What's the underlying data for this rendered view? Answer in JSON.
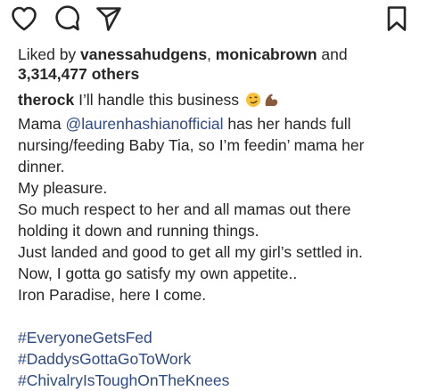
{
  "actions": {
    "like_icon": "heart-outline",
    "comment_icon": "comment-bubble",
    "share_icon": "paper-plane",
    "save_icon": "bookmark-outline"
  },
  "likes": {
    "prefix": "Liked by ",
    "user1": "vanessahudgens",
    "separator": ", ",
    "user2": "monicabrown",
    "and_text": " and",
    "others": "3,314,477 others"
  },
  "caption": {
    "username": "therock",
    "first_line_text": " I’ll handle this business ",
    "emojis": [
      "smirking-face-emoji",
      "flexed-biceps-emoji"
    ],
    "line2_prefix": "Mama ",
    "mention": "@laurenhashianofficial",
    "line2_suffix": " has her hands full",
    "line3": "nursing/feeding Baby Tia, so I’m feedin’ mama her",
    "line4": "dinner.",
    "line5": "My pleasure.",
    "line6": "So much respect to her and all mamas out there",
    "line7": "holding it down and running things.",
    "line8": "Just landed and good to get all my girl’s settled in.",
    "line9": "Now, I gotta go satisfy my own appetite..",
    "line10": "Iron Paradise, here I come.",
    "hashtags": [
      "#EveryoneGetsFed",
      "#DaddysGottaGoToWork",
      "#ChivalryIsToughOnTheKnees"
    ]
  },
  "colors": {
    "text": "#262626",
    "link": "#2d4a86",
    "background": "#ffffff"
  }
}
